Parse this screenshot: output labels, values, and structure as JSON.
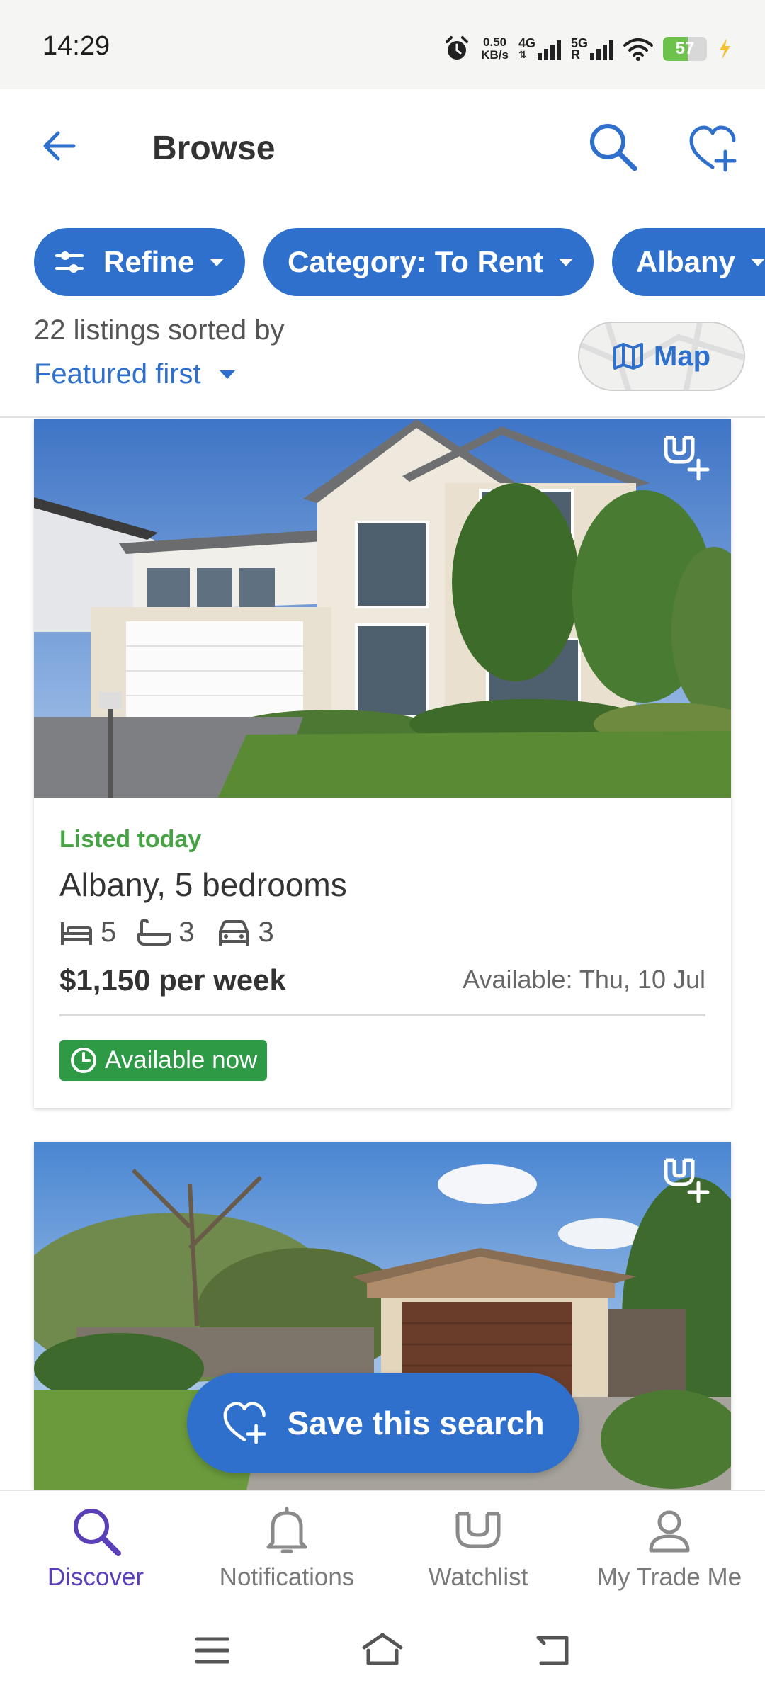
{
  "status_bar": {
    "time": "14:29",
    "net_speed_value": "0.50",
    "net_speed_unit": "KB/s",
    "network_1": "4G",
    "network_2": "5G",
    "sim_2_letter": "R",
    "battery": "57",
    "battery_level": 0.57
  },
  "header": {
    "title": "Browse",
    "icons": [
      "back-arrow-icon",
      "search-icon",
      "heart-plus-icon"
    ]
  },
  "filters": {
    "chips": [
      {
        "label": "Refine",
        "icon": "sliders-icon"
      },
      {
        "label": "Category: To Rent"
      },
      {
        "label": "Albany"
      }
    ]
  },
  "sort": {
    "count_text": "22 listings sorted by",
    "value": "Featured first"
  },
  "map_button": {
    "label": "Map",
    "icon": "map-icon"
  },
  "listings": [
    {
      "status": "Listed today",
      "title": "Albany, 5 bedrooms",
      "bedrooms": "5",
      "bathrooms": "3",
      "parking": "3",
      "price": "$1,150 per week",
      "available": "Available: Thu, 10 Jul",
      "badge": "Available now"
    },
    {}
  ],
  "save_search": {
    "label": "Save this search"
  },
  "bottom_nav": [
    {
      "label": "Discover",
      "icon": "search-icon",
      "active": true
    },
    {
      "label": "Notifications",
      "icon": "bell-icon",
      "active": false
    },
    {
      "label": "Watchlist",
      "icon": "watchlist-icon",
      "active": false
    },
    {
      "label": "My Trade Me",
      "icon": "person-icon",
      "active": false
    }
  ],
  "colors": {
    "primary": "#2f70cc",
    "listed_green": "#46a344",
    "badge_green": "#2e9a46",
    "active_nav": "#5b3fb8"
  }
}
